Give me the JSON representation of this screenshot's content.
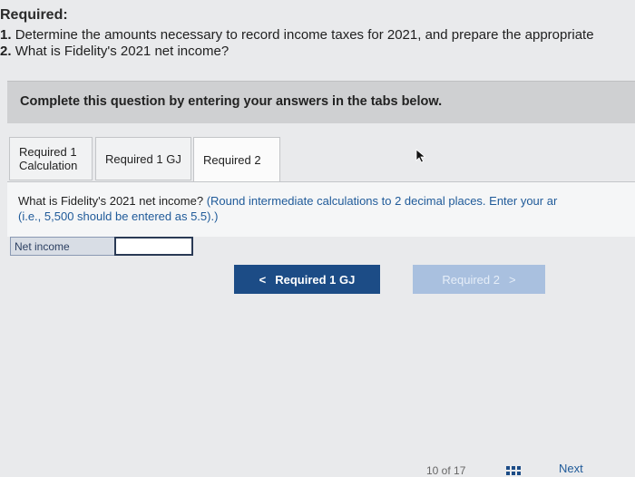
{
  "required": {
    "title": "Required:",
    "items": [
      {
        "num": "1.",
        "text": "Determine the amounts necessary to record income taxes for 2021, and prepare the appropriate"
      },
      {
        "num": "2.",
        "text": "What is Fidelity's 2021 net income?"
      }
    ]
  },
  "banner": {
    "text": "Complete this question by entering your answers in the tabs below."
  },
  "tabs": [
    {
      "label_line1": "Required 1",
      "label_line2": "Calculation"
    },
    {
      "label": "Required 1 GJ"
    },
    {
      "label": "Required 2",
      "active": true
    }
  ],
  "question": {
    "text": "What is Fidelity's 2021 net income?",
    "hint": "(Round intermediate calculations to 2 decimal places. Enter your ar",
    "hint_line2": "(i.e., 5,500 should be entered as 5.5).)"
  },
  "net_income": {
    "label": "Net income",
    "value": ""
  },
  "nav": {
    "prev_arrow": "<",
    "prev_label": "Required 1 GJ",
    "next_label": "Required 2",
    "next_arrow": ">"
  },
  "footer": {
    "pager": "10 of 17",
    "next": "Next"
  },
  "icons": {
    "cursor": "cursor-arrow-icon",
    "grid": "grid-icon"
  }
}
